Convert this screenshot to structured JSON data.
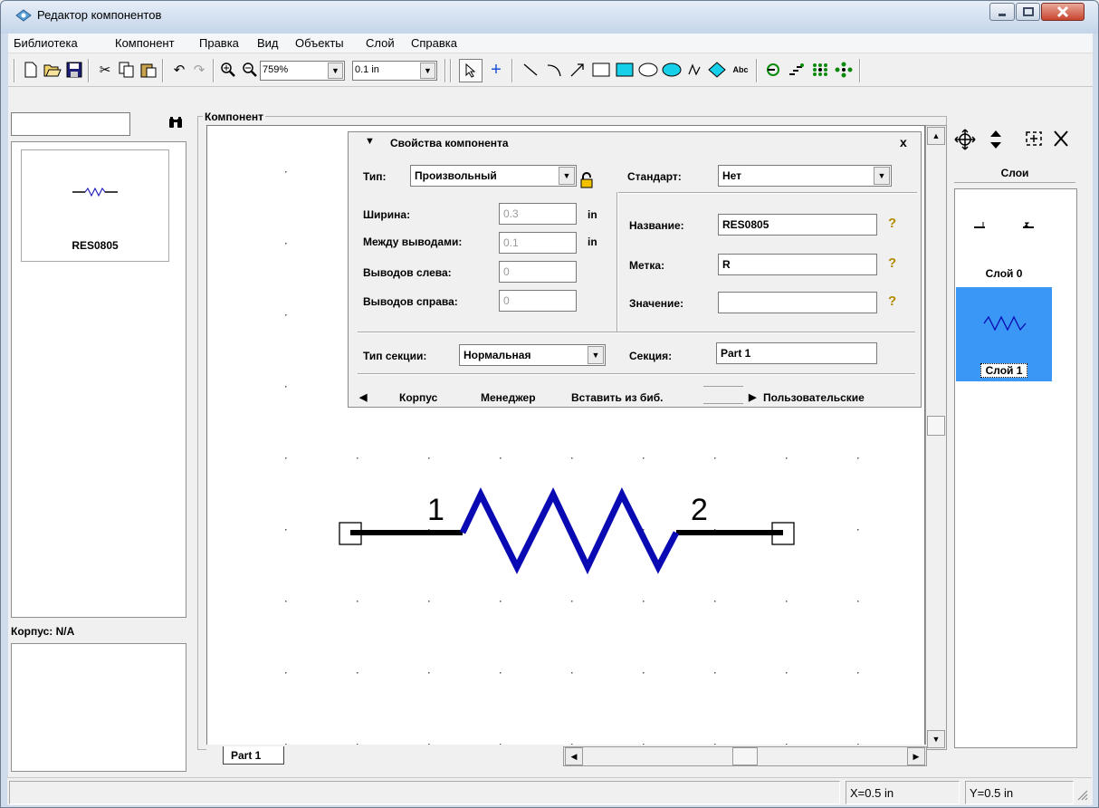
{
  "window": {
    "title": "Редактор компонентов"
  },
  "menu": [
    "Библиотека",
    "Компонент",
    "Правка",
    "Вид",
    "Объекты",
    "Слой",
    "Справка"
  ],
  "toolbar": {
    "zoom": "759%",
    "grid": "0.1 in",
    "icons": [
      "new-icon",
      "open-icon",
      "save-icon",
      "cut-icon",
      "copy-icon",
      "paste-icon",
      "undo-icon",
      "redo-icon",
      "zoom-in-icon",
      "zoom-out-icon",
      "select-icon",
      "pin-icon",
      "line-icon",
      "arc-icon",
      "arrow-icon",
      "rect-icon",
      "filled-rect-icon",
      "ellipse-icon",
      "filled-ellipse-icon",
      "polyline-icon",
      "polygon-icon",
      "text-icon",
      "rotate-pin-icon",
      "pin-array-icon",
      "grid-array-icon",
      "move-pins-icon"
    ],
    "text_btn": "Abc"
  },
  "left": {
    "search_value": "",
    "component_name": "RES0805",
    "package_label": "Корпус: N/A"
  },
  "canvas": {
    "group_label": "Компонент",
    "tab": "Part 1",
    "pin1": "1",
    "pin2": "2"
  },
  "props": {
    "title": "Свойства компонента",
    "close": "x",
    "type_label": "Тип:",
    "type_value": "Произвольный",
    "standard_label": "Стандарт:",
    "standard_value": "Нет",
    "width_label": "Ширина:",
    "width_value": "0.3",
    "pitch_label": "Между выводами:",
    "pitch_value": "0.1",
    "unit": "in",
    "left_pins_label": "Выводов слева:",
    "left_pins_value": "0",
    "right_pins_label": "Выводов справа:",
    "right_pins_value": "0",
    "name_label": "Название:",
    "name_value": "RES0805",
    "designator_label": "Метка:",
    "designator_value": "R",
    "value_label": "Значение:",
    "value_value": "",
    "section_type_label": "Тип секции:",
    "section_type_value": "Нормальная",
    "section_label": "Секция:",
    "section_value": "Part 1",
    "tabs": [
      "Корпус",
      "Менеджер",
      "Вставить из биб.",
      "Пользовательские"
    ]
  },
  "layers": {
    "header": "Слои",
    "items": [
      "Слой 0",
      "Слой 1"
    ]
  },
  "status": {
    "x": "X=0.5 in",
    "y": "Y=0.5 in"
  },
  "colors": {
    "accent": "#3a97f5",
    "resistor": "#0a0ab4",
    "close": "#c7452f"
  }
}
